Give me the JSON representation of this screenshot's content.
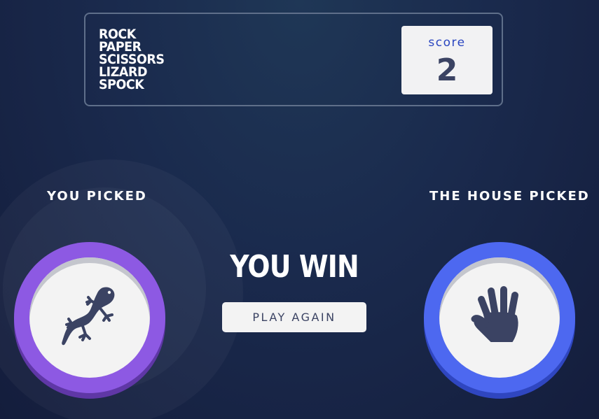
{
  "header": {
    "logo_lines": [
      "ROCK",
      "PAPER",
      "SCISSORS",
      "LIZARD",
      "SPOCK"
    ],
    "score_label": "score",
    "score_value": "2"
  },
  "game": {
    "you_picked_label": "YOU PICKED",
    "house_picked_label": "THE HOUSE PICKED",
    "player_choice": "lizard",
    "house_choice": "paper",
    "result": "YOU WIN",
    "play_again_label": "PLAY AGAIN"
  },
  "colors": {
    "lizard_ring": "#8d59e3",
    "paper_ring": "#4d68f0",
    "score_label": "#2a46c0",
    "dark_text": "#3b4363"
  },
  "icons": {
    "player": "lizard-icon",
    "house": "paper-hand-icon"
  }
}
